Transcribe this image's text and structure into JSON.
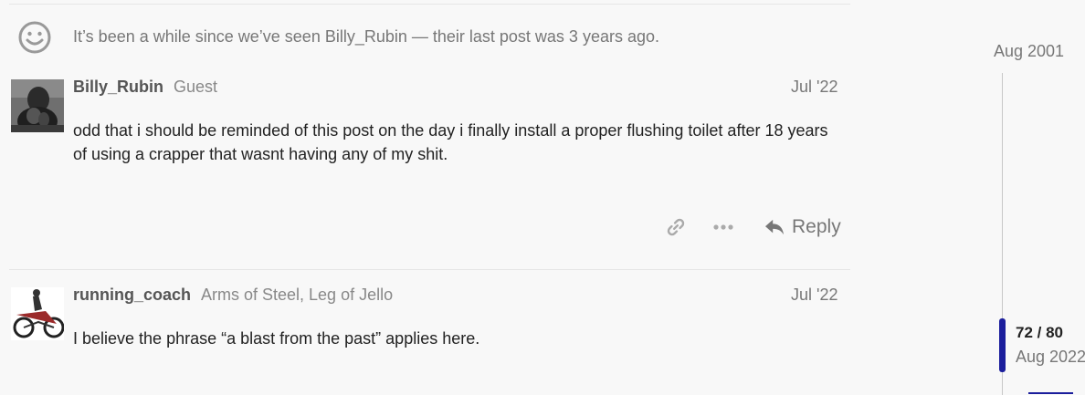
{
  "notice": {
    "text": "It’s been a while since we’ve seen Billy_Rubin — their last post was 3 years ago."
  },
  "posts": [
    {
      "username": "Billy_Rubin",
      "user_title": "Guest",
      "date": "Jul '22",
      "body": "odd that i should be reminded of this post on the day i finally install a proper flushing toilet after 18 years of using a crapper that wasnt having any of my shit.",
      "actions": {
        "link_icon": "link-icon",
        "more_icon": "ellipsis-icon",
        "reply_label": "Reply"
      }
    },
    {
      "username": "running_coach",
      "user_title": "Arms of Steel, Leg of Jello",
      "date": "Jul '22",
      "body": "I believe the phrase “a blast from the past” applies here."
    }
  ],
  "timeline": {
    "start_label": "Aug 2001",
    "position": "72 / 80",
    "end_label": "Aug 2022",
    "progress": 0.9
  },
  "colors": {
    "accent": "#1b1e9c",
    "muted_text": "#777777",
    "background": "#f8f8f8"
  }
}
